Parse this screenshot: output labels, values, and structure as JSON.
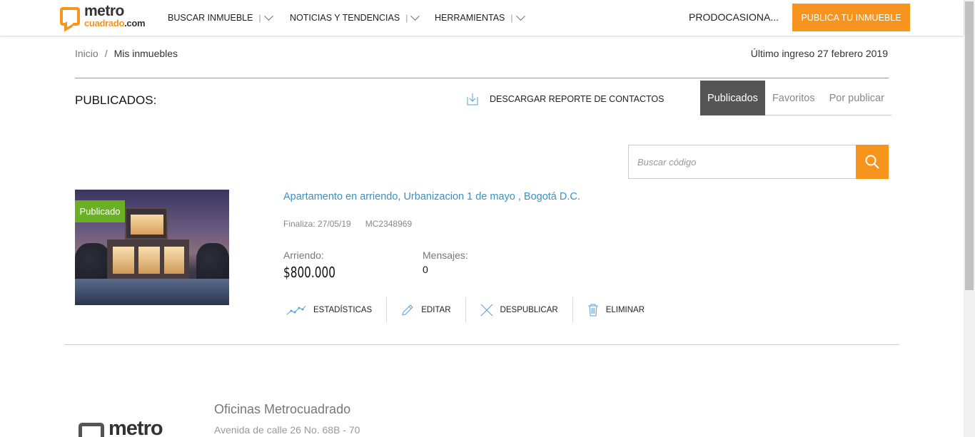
{
  "header": {
    "logo_top": "metro",
    "logo_bottom": "cuadrado",
    "logo_suffix": ".com",
    "nav": [
      {
        "label": "BUSCAR INMUEBLE",
        "sep": "|"
      },
      {
        "label": "NOTICIAS Y TENDENCIAS",
        "sep": "|"
      },
      {
        "label": "HERRAMIENTAS",
        "sep": "|"
      }
    ],
    "user_name": "PRODOCASIONA...",
    "publish_label": "PUBLICA TU INMUEBLE"
  },
  "breadcrumb": {
    "home": "Inicio",
    "separator": "/",
    "current": "Mis inmuebles"
  },
  "last_login": "Último ingreso 27 febrero 2019",
  "section": {
    "title": "PUBLICADOS:",
    "download_label": "DESCARGAR REPORTE DE CONTACTOS"
  },
  "tabs": [
    {
      "label": "Publicados",
      "active": true
    },
    {
      "label": "Favoritos",
      "active": false
    },
    {
      "label": "Por publicar",
      "active": false
    }
  ],
  "search": {
    "placeholder": "Buscar código",
    "value": ""
  },
  "listing": {
    "badge": "Publicado",
    "title": "Apartamento en arriendo, Urbanizacion 1 de mayo , Bogotá D.C.",
    "ends": "Finaliza: 27/05/19",
    "code": "MC2348969",
    "price_label": "Arriendo:",
    "price_value": "$800.000",
    "messages_label": "Mensajes:",
    "messages_value": "0",
    "actions": [
      {
        "label": "ESTADÍSTICAS",
        "icon": "stats-icon"
      },
      {
        "label": "EDITAR",
        "icon": "pencil-icon"
      },
      {
        "label": "DESPUBLICAR",
        "icon": "close-icon"
      },
      {
        "label": "ELIMINAR",
        "icon": "trash-icon"
      }
    ]
  },
  "footer": {
    "logo_word": "metro",
    "office_title": "Oficinas Metrocuadrado",
    "office_address": "Avenida de calle 26 No. 68B - 70"
  },
  "colors": {
    "accent": "#f7941d",
    "link": "#3a91c6",
    "badge": "#6ab023",
    "active_tab": "#555555"
  }
}
